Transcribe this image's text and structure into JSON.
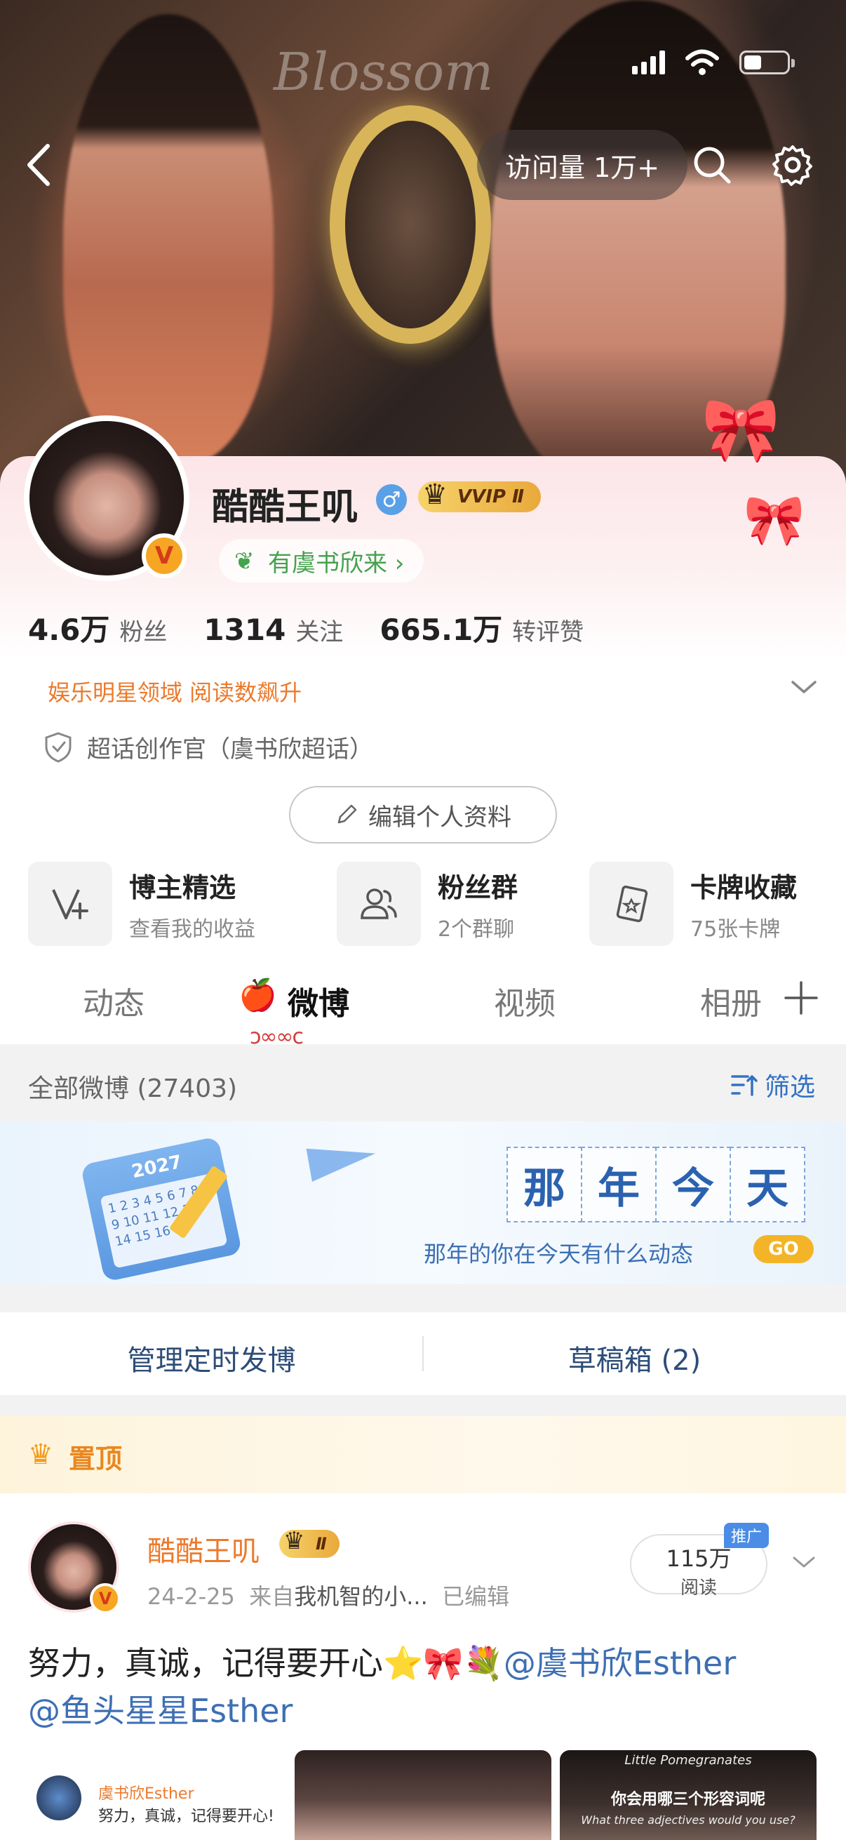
{
  "banner": {
    "watermark_text": "Blossom",
    "visits_label": "访问量 1万+",
    "colors": {
      "overlay_pill": "#463c3c"
    }
  },
  "profile": {
    "nickname": "酷酷王叽",
    "vip_label": "VVIP Ⅱ",
    "gender_symbol": "♂",
    "fan_pill_label": "有虞书欣来 ›",
    "verified_mark": "V",
    "stats": [
      {
        "num": "4.6万",
        "label": "粉丝"
      },
      {
        "num": "1314",
        "label": "关注"
      },
      {
        "num": "665.1万",
        "label": "转评赞"
      }
    ],
    "domain_text": "娱乐明星领域 阅读数飙升",
    "super_topic_text": "超话创作官（虞书欣超话）",
    "edit_button_label": "编辑个人资料"
  },
  "shortcuts": [
    {
      "title": "博主精选",
      "sub": "查看我的收益",
      "icon": "v-plus-icon"
    },
    {
      "title": "粉丝群",
      "sub": "2个群聊",
      "icon": "group-icon"
    },
    {
      "title": "卡牌收藏",
      "sub": "75张卡牌",
      "icon": "card-icon"
    }
  ],
  "tabs": [
    {
      "label": "动态",
      "active": false
    },
    {
      "label": "微博",
      "active": true
    },
    {
      "label": "视频",
      "active": false
    },
    {
      "label": "相册",
      "active": false
    }
  ],
  "filter": {
    "count_label": "全部微博 (27403)",
    "filter_label": "筛选"
  },
  "memories": {
    "calendar_year": "2027",
    "calendar_numbers": "1 2 3 4 5 6 7 8 9 10 11 12 13 14 15 16",
    "chars": [
      "那",
      "年",
      "今",
      "天"
    ],
    "subtitle": "那年的你在今天有什么动态",
    "go_label": "GO"
  },
  "actions": {
    "scheduled_label": "管理定时发博",
    "drafts_label": "草稿箱 (2)"
  },
  "pinned": {
    "label": "置顶"
  },
  "post": {
    "author": "酷酷王叽",
    "vip_label": "Ⅱ",
    "date": "24-2-25",
    "source_prefix": "来自",
    "source": "我机智的小...",
    "edited": "已编辑",
    "read_count": "115万",
    "read_label": "阅读",
    "promo_label": "推广",
    "text_main": "努力，真诚，记得要开心⭐🎀💐",
    "mention_1": "@虞书欣Esther",
    "mention_2": "@鱼头星星Esther",
    "quote_name": "虞书欣Esther",
    "quote_text": "努力，真诚，记得要开心!",
    "media_2_top": "Little Pomegranates",
    "media_2_title": "你会用哪三个形容词呢",
    "media_2_sub": "What three adjectives would you use?"
  },
  "colors": {
    "accent_orange": "#ec7a2c",
    "link_blue": "#3272c4",
    "mention_blue": "#3d6fb3",
    "vip_gold": "#f6d36b"
  }
}
